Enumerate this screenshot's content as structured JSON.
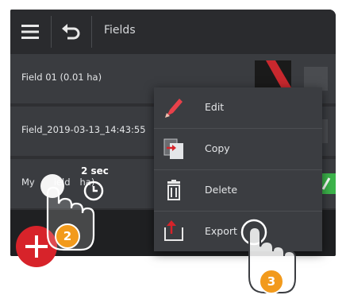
{
  "header": {
    "title": "Fields",
    "menu_icon": "hamburger-icon",
    "back_icon": "back-arrow-icon"
  },
  "fields": [
    {
      "label": "Field 01 (0.01 ha)"
    },
    {
      "label": "Field_2019-03-13_14:43:55"
    },
    {
      "label_left": "My",
      "label_mid": "ield",
      "label_right": "ha)"
    }
  ],
  "context_menu": {
    "items": [
      {
        "label": "Edit",
        "icon": "pencil-icon"
      },
      {
        "label": "Copy",
        "icon": "copy-icon"
      },
      {
        "label": "Delete",
        "icon": "trash-icon"
      },
      {
        "label": "Export",
        "icon": "export-icon"
      }
    ]
  },
  "fab": {
    "icon": "plus-icon",
    "color": "#d7232a"
  },
  "gesture": {
    "long_press_hint": "2 sec",
    "step_2": "2",
    "step_3": "3",
    "badge_color": "#f29a1c"
  },
  "colors": {
    "accent_green": "#3cb44b",
    "header_bg": "#2a2b2e",
    "row_bg": "#3a3c40"
  }
}
